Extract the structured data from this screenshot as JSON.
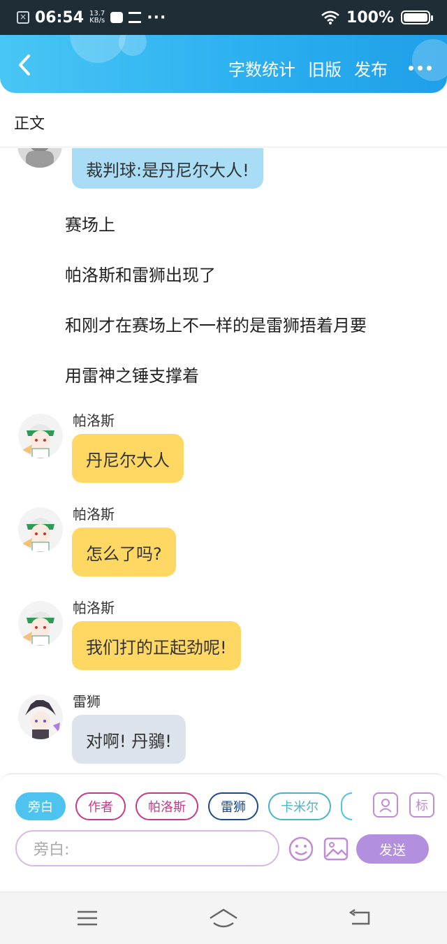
{
  "status_bar": {
    "time": "06:54",
    "net_speed_value": "13.7",
    "net_speed_unit": "KB/s",
    "dots": "···",
    "battery": "100%"
  },
  "header": {
    "back_icon": "chevron-left-icon",
    "word_count": "字数统计",
    "old_version": "旧版",
    "publish": "发布",
    "more_icon": "more-dots-icon"
  },
  "section_label": "正文",
  "messages": [
    {
      "kind": "bubble",
      "speaker": "",
      "text": "裁判球:是丹尼尔大人!",
      "color": "blue"
    },
    {
      "kind": "narration",
      "text": "赛场上"
    },
    {
      "kind": "narration",
      "text": "帕洛斯和雷狮出现了"
    },
    {
      "kind": "narration",
      "text": "和刚才在赛场上不一样的是雷狮捂着月要"
    },
    {
      "kind": "narration",
      "text": "用雷神之锤支撑着"
    },
    {
      "kind": "bubble",
      "speaker": "帕洛斯",
      "text": "丹尼尔大人",
      "color": "yellow"
    },
    {
      "kind": "bubble",
      "speaker": "帕洛斯",
      "text": "怎么了吗?",
      "color": "yellow"
    },
    {
      "kind": "bubble",
      "speaker": "帕洛斯",
      "text": "我们打的正起劲呢!",
      "color": "yellow"
    },
    {
      "kind": "bubble",
      "speaker": "雷狮",
      "text": "对啊! 丹鶸!",
      "color": "grey"
    }
  ],
  "role_chips": [
    {
      "label": "旁白",
      "active": true
    },
    {
      "label": "作者",
      "active": false
    },
    {
      "label": "帕洛斯",
      "active": false
    },
    {
      "label": "雷狮",
      "active": false
    },
    {
      "label": "卡米尔",
      "active": false
    }
  ],
  "panel": {
    "character_icon": "user-card-icon",
    "tag_label": "标",
    "input_placeholder": "旁白:",
    "emoji_icon": "smile-icon",
    "image_icon": "image-icon",
    "send_label": "发送"
  },
  "nav": {
    "menu_icon": "menu-icon",
    "home_icon": "home-icon",
    "back_icon": "back-icon"
  },
  "colors": {
    "header_blue": "#2aaeef",
    "bubble_blue": "#a8ddf5",
    "bubble_yellow": "#ffd863",
    "bubble_grey": "#dde3ea",
    "send_purple": "#b38fe0"
  }
}
